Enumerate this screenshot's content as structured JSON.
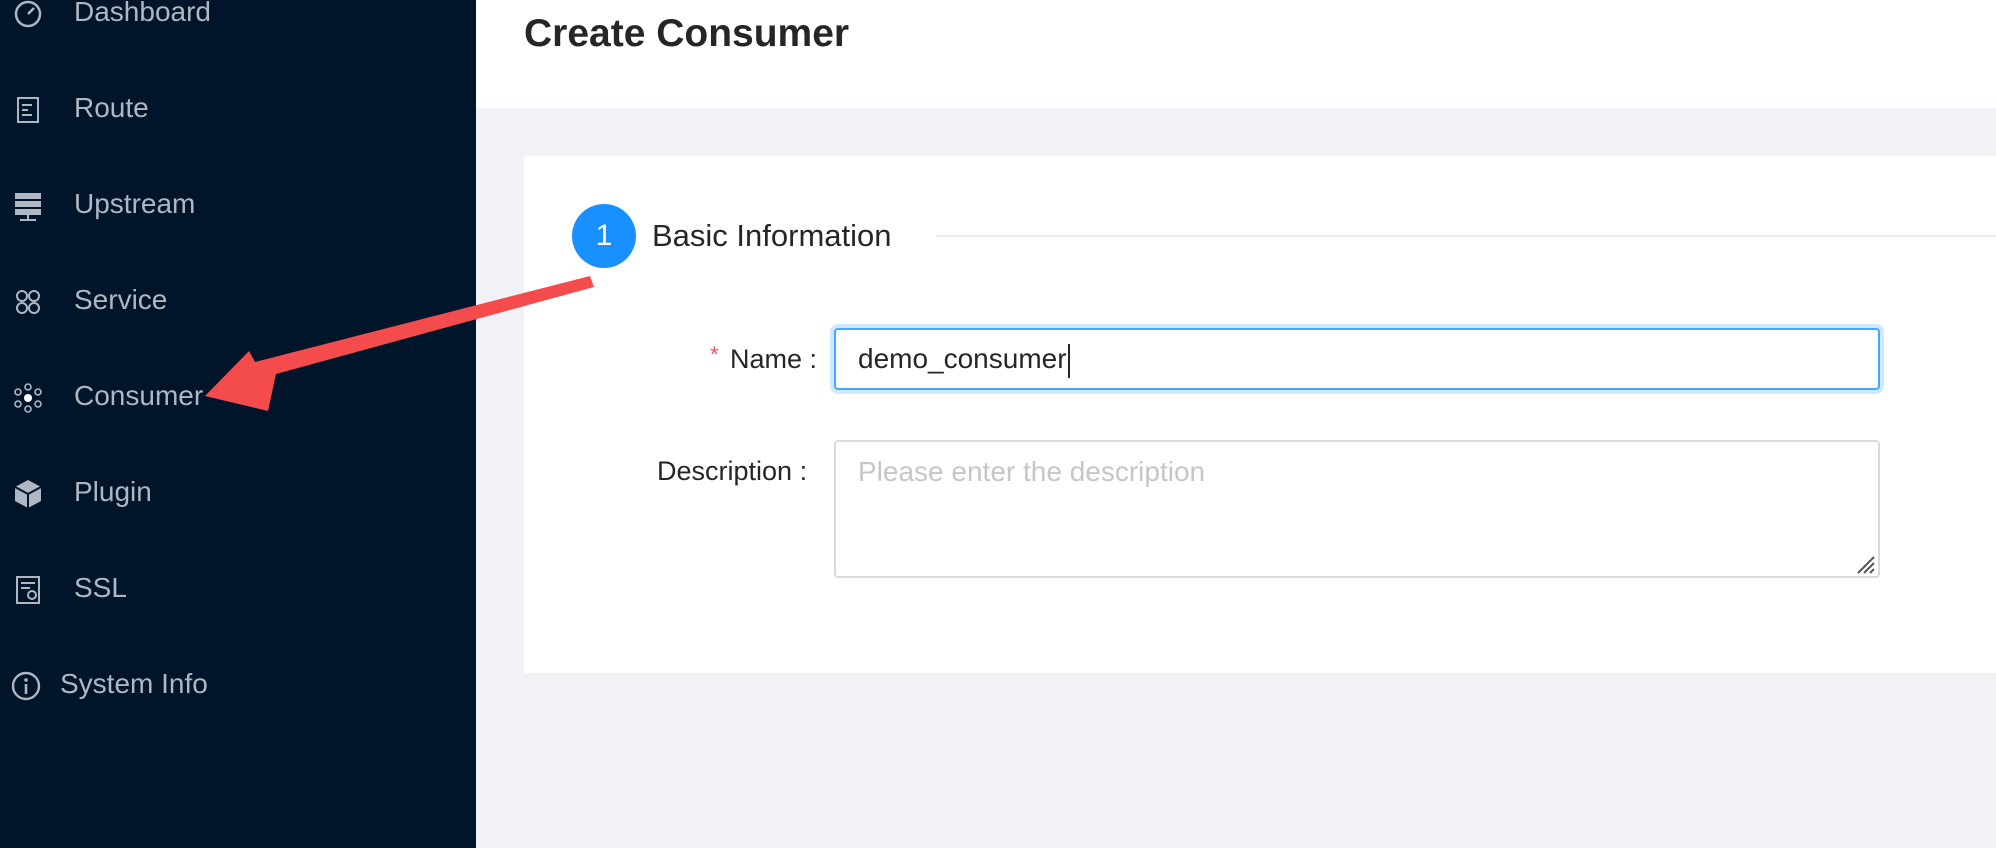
{
  "sidebar": {
    "items": [
      {
        "label": "Dashboard",
        "icon": "dashboard-icon"
      },
      {
        "label": "Route",
        "icon": "route-icon"
      },
      {
        "label": "Upstream",
        "icon": "server-icon"
      },
      {
        "label": "Service",
        "icon": "command-icon"
      },
      {
        "label": "Consumer",
        "icon": "cluster-icon"
      },
      {
        "label": "Plugin",
        "icon": "cube-icon"
      },
      {
        "label": "SSL",
        "icon": "certificate-icon"
      },
      {
        "label": "System Info",
        "icon": "info-icon"
      }
    ]
  },
  "header": {
    "title": "Create Consumer"
  },
  "form": {
    "step_number": "1",
    "step_title": "Basic Information",
    "name_label": "Name",
    "name_value": "demo_consumer",
    "description_label": "Description",
    "description_placeholder": "Please enter the description"
  },
  "colors": {
    "sidebar_bg": "#001529",
    "primary": "#1890ff",
    "arrow": "#f44c4c",
    "required": "#ff4d4f"
  }
}
